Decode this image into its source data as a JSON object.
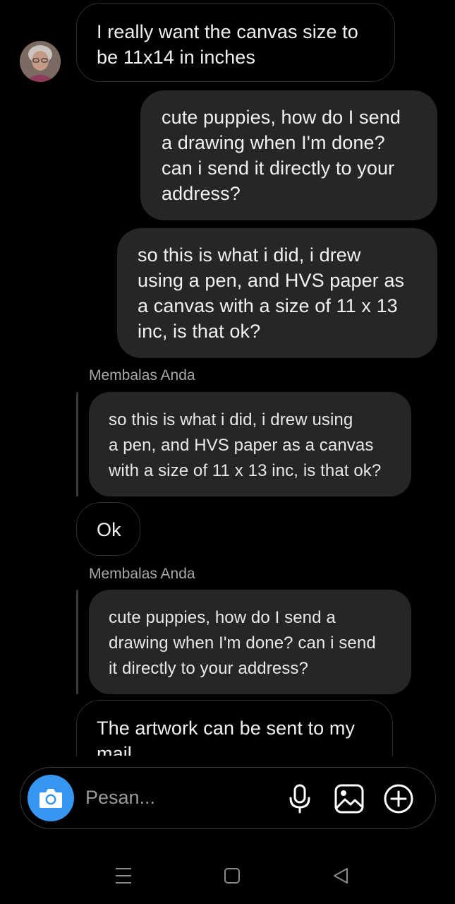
{
  "conversation": {
    "messages": [
      {
        "id": "m1",
        "direction": "incoming",
        "text": "I really want the canvas size to\nbe 11x14 in inches"
      },
      {
        "id": "m2",
        "direction": "outgoing",
        "text": "cute puppies, how do I send\na drawing when I'm done?\ncan i send it directly to your\naddress?"
      },
      {
        "id": "m3",
        "direction": "outgoing",
        "text": "so this is what i did, i drew\nusing a pen, and HVS paper as\na canvas with a size of 11 x 13\ninc, is that ok?"
      },
      {
        "id": "q1",
        "direction": "incoming",
        "reply_label": "Membalas Anda",
        "quoted_text": "so this is what i did, i drew using\na pen, and HVS paper as a canvas\nwith a size of 11 x 13 inc, is that ok?"
      },
      {
        "id": "m4",
        "direction": "incoming",
        "text": "Ok"
      },
      {
        "id": "q2",
        "direction": "incoming",
        "reply_label": "Membalas Anda",
        "quoted_text": "cute puppies, how do I send a\ndrawing when I'm done?  can i send\nit directly to your address?"
      },
      {
        "id": "m5",
        "direction": "incoming",
        "text": "The artwork can be sent to my\nmail"
      }
    ]
  },
  "composer": {
    "placeholder": "Pesan...",
    "value": "",
    "camera_icon": "camera-icon",
    "mic_icon": "microphone-icon",
    "gallery_icon": "gallery-icon",
    "plus_icon": "plus-circle-icon",
    "accent_color": "#3797f0"
  },
  "system_nav": {
    "icons": [
      "menu-icon",
      "home-icon",
      "back-icon"
    ]
  },
  "colors": {
    "background": "#000000",
    "outgoing_bubble": "#262626",
    "incoming_border": "#2e2e2e",
    "reply_label": "#a8a8a8"
  }
}
